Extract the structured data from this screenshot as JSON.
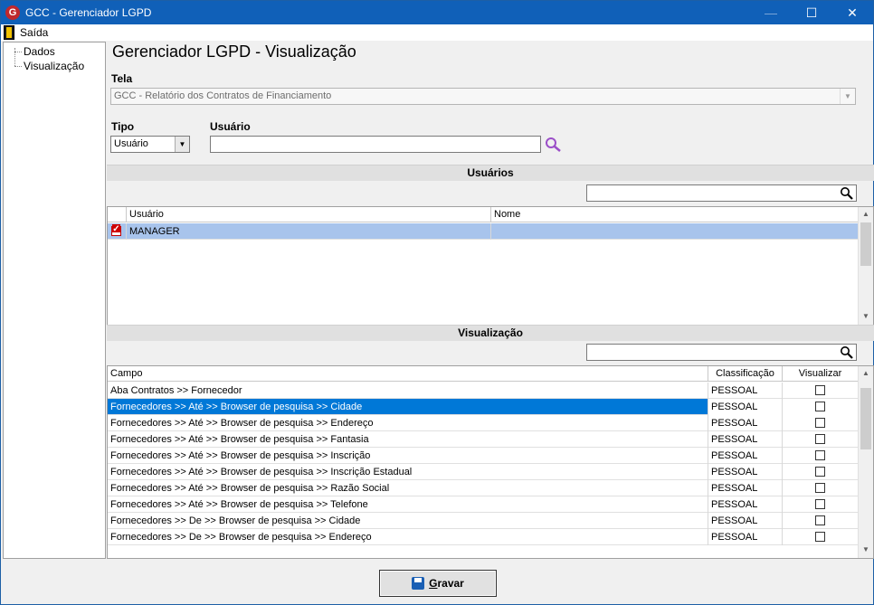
{
  "window": {
    "title": "GCC - Gerenciador LGPD",
    "app_icon_letter": "G"
  },
  "menu": {
    "saida": "Saída"
  },
  "tree": {
    "items": [
      "Dados",
      "Visualização"
    ]
  },
  "heading": "Gerenciador LGPD - Visualização",
  "tela": {
    "label": "Tela",
    "value": "GCC - Relatório dos Contratos de Financiamento"
  },
  "tipo": {
    "label": "Tipo",
    "value": "Usuário"
  },
  "usuario": {
    "label": "Usuário",
    "value": ""
  },
  "usuarios_section": {
    "title": "Usuários",
    "filter_value": "",
    "columns": [
      "Usuário",
      "Nome"
    ],
    "rows": [
      {
        "checked": true,
        "usuario": "MANAGER",
        "nome": ""
      }
    ]
  },
  "visualizacao_section": {
    "title": "Visualização",
    "filter_value": "",
    "columns": [
      "Campo",
      "Classificação",
      "Visualizar"
    ],
    "rows": [
      {
        "campo": "Aba Contratos >> Fornecedor",
        "classificacao": "PESSOAL",
        "visualizar": false
      },
      {
        "campo": "Fornecedores >> Até >> Browser de pesquisa >> Cidade",
        "classificacao": "PESSOAL",
        "visualizar": false
      },
      {
        "campo": "Fornecedores >> Até >> Browser de pesquisa >> Endereço",
        "classificacao": "PESSOAL",
        "visualizar": false
      },
      {
        "campo": "Fornecedores >> Até >> Browser de pesquisa >> Fantasia",
        "classificacao": "PESSOAL",
        "visualizar": false
      },
      {
        "campo": "Fornecedores >> Até >> Browser de pesquisa >> Inscrição",
        "classificacao": "PESSOAL",
        "visualizar": false
      },
      {
        "campo": "Fornecedores >> Até >> Browser de pesquisa >> Inscrição Estadual",
        "classificacao": "PESSOAL",
        "visualizar": false
      },
      {
        "campo": "Fornecedores >> Até >> Browser de pesquisa >> Razão Social",
        "classificacao": "PESSOAL",
        "visualizar": false
      },
      {
        "campo": "Fornecedores >> Até >> Browser de pesquisa >> Telefone",
        "classificacao": "PESSOAL",
        "visualizar": false
      },
      {
        "campo": "Fornecedores >> De >> Browser de pesquisa >> Cidade",
        "classificacao": "PESSOAL",
        "visualizar": false
      },
      {
        "campo": "Fornecedores >> De >> Browser de pesquisa >> Endereço",
        "classificacao": "PESSOAL",
        "visualizar": false
      }
    ],
    "selected_row_index": 1
  },
  "buttons": {
    "gravar_prefix": "G",
    "gravar_rest": "ravar"
  },
  "colors": {
    "titlebar": "#1060b8",
    "selection_blue": "#0078d7",
    "row_highlight": "#a8c4ec"
  }
}
